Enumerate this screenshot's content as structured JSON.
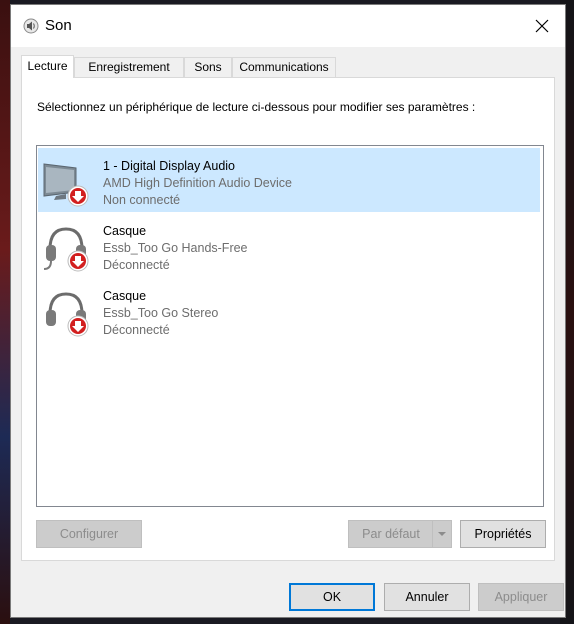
{
  "window": {
    "title": "Son",
    "close_label": "✕"
  },
  "tabs": [
    {
      "label": "Lecture",
      "active": true
    },
    {
      "label": "Enregistrement",
      "active": false
    },
    {
      "label": "Sons",
      "active": false
    },
    {
      "label": "Communications",
      "active": false
    }
  ],
  "panel": {
    "instructions": "Sélectionnez un périphérique de lecture ci-dessous pour modifier ses paramètres :"
  },
  "devices": [
    {
      "name": "1 - Digital Display Audio",
      "description": "AMD High Definition Audio Device",
      "status": "Non connecté",
      "icon": "monitor-icon",
      "selected": true
    },
    {
      "name": "Casque",
      "description": "Essb_Too Go Hands-Free",
      "status": "Déconnecté",
      "icon": "headset-icon",
      "selected": false
    },
    {
      "name": "Casque",
      "description": "Essb_Too Go Stereo",
      "status": "Déconnecté",
      "icon": "headphones-icon",
      "selected": false
    }
  ],
  "panel_buttons": {
    "configure": "Configurer",
    "default": "Par défaut",
    "properties": "Propriétés"
  },
  "dialog_buttons": {
    "ok": "OK",
    "cancel": "Annuler",
    "apply": "Appliquer"
  },
  "colors": {
    "selection": "#cce8ff",
    "accent": "#0078d7",
    "status_arrow": "#d21f1f"
  }
}
